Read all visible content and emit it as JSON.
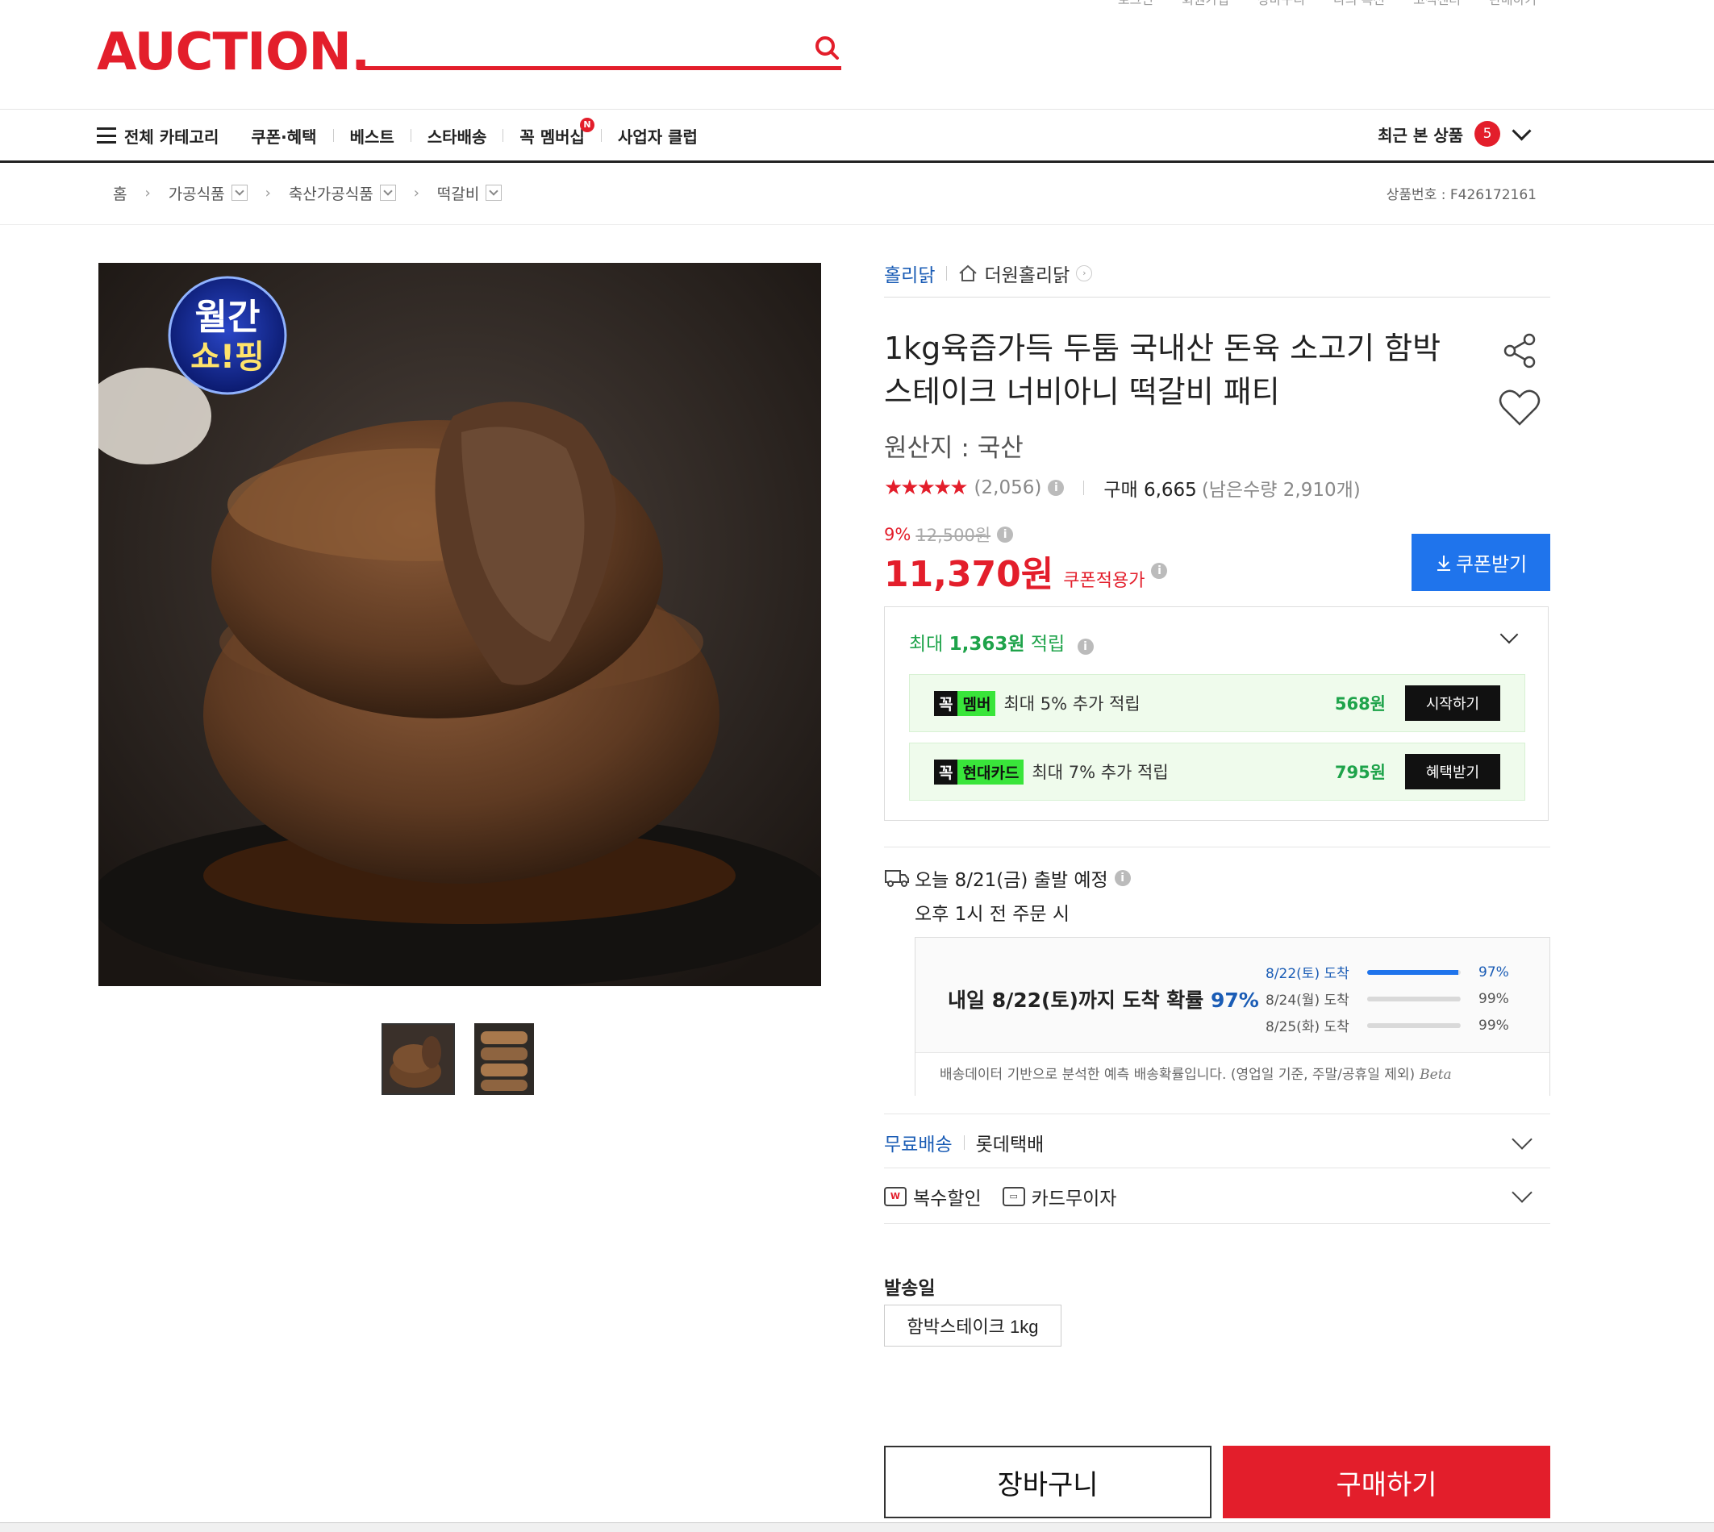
{
  "header": {
    "logo": "AUCTION.",
    "search_placeholder": "",
    "util_links": [
      "로그인",
      "회원가입",
      "장바구니",
      "나의 옥션",
      "고객센터",
      "판매하기"
    ]
  },
  "nav": {
    "all_categories": "전체 카테고리",
    "items": [
      "쿠폰·혜택",
      "베스트",
      "스타배송",
      "꼭 멤버십",
      "사업자 클럽"
    ],
    "new_badge": "N",
    "recent_label": "최근 본 상품",
    "recent_count": "5"
  },
  "breadcrumb": {
    "home": "홈",
    "items": [
      "가공식품",
      "축산가공식품",
      "떡갈비"
    ],
    "product_no": "상품번호 : F426172161"
  },
  "image": {
    "badge_line1": "월간",
    "badge_line2": "쇼!핑"
  },
  "product": {
    "brand": "홀리닭",
    "shop": "더원홀리닭",
    "title": "1kg육즙가득 두툼 국내산 돈육 소고기 함박스테이크 너비아니 떡갈비 패티",
    "origin": "원산지 : 국산",
    "rating_stars": "★★★★★",
    "rating": 4.5,
    "review_count": "(2,056)",
    "purchase": "구매 6,665",
    "remaining": "(남은수량 2,910개)",
    "discount_pct": "9%",
    "original_price": "12,500원",
    "price": "11,370원",
    "price_label": "쿠폰적용가",
    "coupon_button": "쿠폰받기"
  },
  "reward": {
    "head_prefix": "최대 ",
    "head_amount": "1,363원",
    "head_suffix": " 적립",
    "rows": [
      {
        "tag_k": "꼭",
        "tag_g": "멤버",
        "text": "최대 5% 추가 적립",
        "amount": "568원",
        "button": "시작하기"
      },
      {
        "tag_k": "꼭",
        "tag_g": "현대카드",
        "text": "최대 7% 추가 적립",
        "amount": "795원",
        "button": "혜택받기"
      }
    ]
  },
  "shipping": {
    "line1": "오늘 8/21(금) 출발 예정",
    "line2": "오후 1시 전 주문 시",
    "prob_title": "내일 8/22(토)까지 도착 확률 ",
    "prob_pct": "97%",
    "rows": [
      {
        "date": "8/22(토) 도착",
        "pct": "97%",
        "value": 0.97
      },
      {
        "date": "8/24(월) 도착",
        "pct": "99%",
        "value": 0.99
      },
      {
        "date": "8/25(화) 도착",
        "pct": "99%",
        "value": 0.99
      }
    ],
    "footnote": "배송데이터 기반으로 분석한 예측 배송확률입니다. (영업일 기준, 주말/공휴일 제외)",
    "beta": "Beta",
    "free": "무료배송",
    "courier": "롯데택배",
    "multi_discount": "복수할인",
    "card_installment": "카드무이자"
  },
  "options": {
    "label": "발송일",
    "selected": "함박스테이크 1kg"
  },
  "actions": {
    "cart": "장바구니",
    "buy": "구매하기"
  },
  "colors": {
    "brand": "#e31e2b",
    "link_blue": "#1a5cb5",
    "coupon_blue": "#1f74ec",
    "reward_green": "#1ea34a"
  }
}
